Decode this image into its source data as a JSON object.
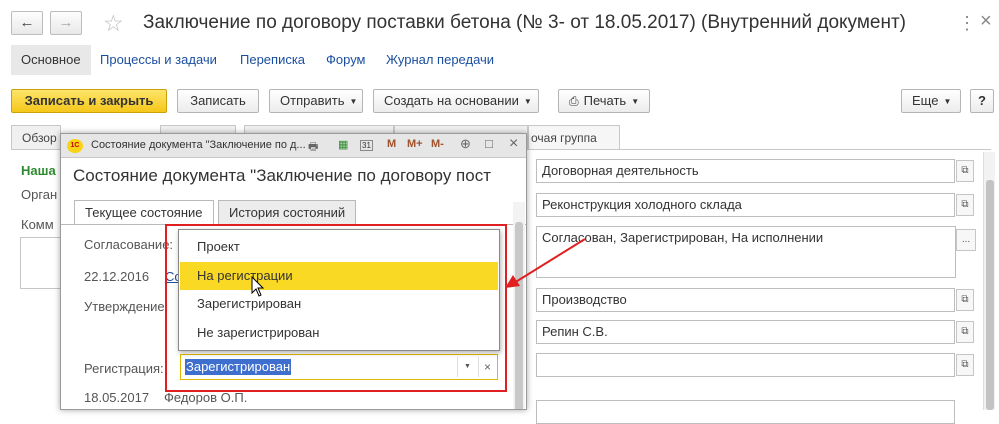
{
  "nav": {
    "back_icon": "←",
    "forward_icon": "→",
    "star_icon": "☆"
  },
  "window_title": "Заключение по договору поставки бетона (№ 3- от 18.05.2017) (Внутренний документ)",
  "header_menu_icon": "⋮",
  "close_icon": "×",
  "section_tabs": [
    "Основное",
    "Процессы и задачи",
    "Переписка",
    "Форум",
    "Журнал передачи"
  ],
  "toolbar": {
    "save_close": "Записать и закрыть",
    "save": "Записать",
    "send": "Отправить",
    "create_based": "Создать на основании",
    "print": "Печать",
    "more": "Еще",
    "help": "?"
  },
  "bg": {
    "tab1": "Обзор",
    "tab_group": "очая группа",
    "left_heading": "Наша",
    "left_org": "Орган",
    "left_comment": "Комм",
    "fields": [
      "Договорная деятельность",
      "Реконструкция холодного склада",
      "Согласован, Зарегистрирован, На исполнении",
      "Производство",
      "Репин С.В.",
      ""
    ],
    "ellipsis": "..."
  },
  "modal": {
    "logo": "1С",
    "bar_title": "Состояние документа \"Заключение по д...",
    "heading": "Состояние документа \"Заключение по договору пост",
    "tab_current": "Текущее состояние",
    "tab_history": "История состояний",
    "label_approval": "Согласование:",
    "approval_date": "22.12.2016",
    "approval_link": "Со",
    "label_confirm": "Утверждение:",
    "label_registration": "Регистрация:",
    "registration_value": "Зарегистрирован",
    "registration_date": "18.05.2017",
    "registration_person": "Федоров О.П.",
    "toolbar_icons": {
      "calc": "▦",
      "calendar": "31",
      "m": "M",
      "mplus": "M+",
      "mminus": "M-",
      "zoom": "⊕",
      "window": "□",
      "close": "×"
    }
  },
  "dropdown": {
    "options": [
      "Проект",
      "На регистрации",
      "Зарегистрирован",
      "Не зарегистрирован"
    ],
    "highlighted": "На регистрации"
  },
  "colors": {
    "accent_yellow": "#f9d924",
    "link_blue": "#1b4fa0",
    "annotation_red": "#e02020",
    "green_heading": "#2f8a2f"
  }
}
